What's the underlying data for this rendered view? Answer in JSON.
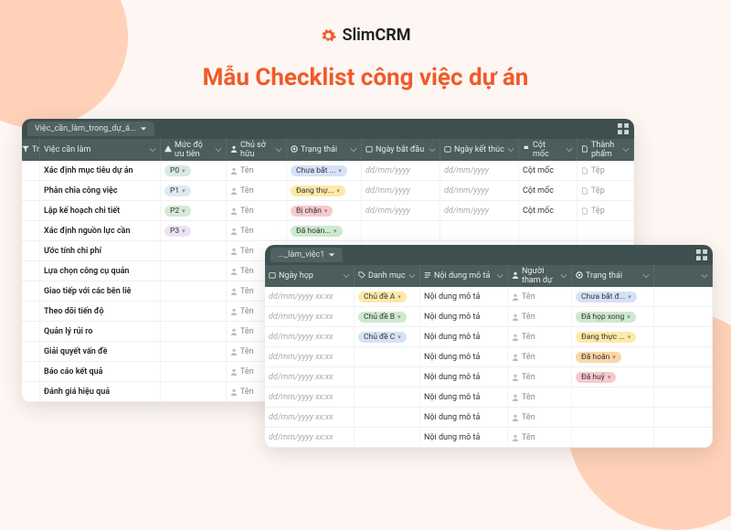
{
  "brand": {
    "slim": "Slim",
    "crm": "CRM"
  },
  "headline": "Mẫu Checklist công việc dự án",
  "colors": {
    "accent": "#f05a28",
    "header_bg": "#4b5d5c",
    "tabbar_bg": "#3d4f4f"
  },
  "panel_a": {
    "tab": "Việc_cần_làm_trong_dự_á...",
    "columns": [
      "Tr",
      "Việc cần làm",
      "Mức độ ưu tiên",
      "Chủ sở hữu",
      "Trạng thái",
      "Ngày bắt đầu",
      "Ngày kết thúc",
      "Cột mốc",
      "Thành phẩm"
    ],
    "icons": [
      "filter",
      "",
      "priority",
      "person",
      "status",
      "calendar",
      "calendar",
      "milestone",
      "file"
    ],
    "priority_colors": {
      "P0": "#d7e9e2",
      "P1": "#dfe9f5",
      "P2": "#d4ead6",
      "P3": "#ece3f2"
    },
    "status_colors": {
      "Chưa bắt ...": "#d7e1f7",
      "Đang thự...": "#fde9a8",
      "Bị chặn": "#f7c9ce",
      "Đã hoàn...": "#cde9cf"
    },
    "rows": [
      {
        "task": "Xác định mục tiêu dự án",
        "priority": "P0",
        "owner": "Tên",
        "status": "Chưa bắt ...",
        "start": "dd/mm/yyyy",
        "end": "dd/mm/yyyy",
        "milestone": "Cột mốc",
        "file": "Tệp"
      },
      {
        "task": "Phân chia công việc",
        "priority": "P1",
        "owner": "Tên",
        "status": "Đang thự...",
        "start": "dd/mm/yyyy",
        "end": "dd/mm/yyyy",
        "milestone": "Cột mốc",
        "file": "Tệp"
      },
      {
        "task": "Lập kế hoạch chi tiết",
        "priority": "P2",
        "owner": "Tên",
        "status": "Bị chặn",
        "start": "dd/mm/yyyy",
        "end": "dd/mm/yyyy",
        "milestone": "Cột mốc",
        "file": "Tệp"
      },
      {
        "task": "Xác định nguồn lực cần",
        "priority": "P3",
        "owner": "Tên",
        "status": "Đã hoàn...",
        "start": "",
        "end": "",
        "milestone": "",
        "file": ""
      },
      {
        "task": "Ước tính chi phí",
        "priority": "",
        "owner": "Tên",
        "status": "",
        "start": "",
        "end": "",
        "milestone": "",
        "file": ""
      },
      {
        "task": "Lựa chọn công cụ quản",
        "priority": "",
        "owner": "Tên",
        "status": "",
        "start": "",
        "end": "",
        "milestone": "",
        "file": ""
      },
      {
        "task": "Giao tiếp với các bên liê",
        "priority": "",
        "owner": "Tên",
        "status": "",
        "start": "",
        "end": "",
        "milestone": "",
        "file": ""
      },
      {
        "task": "Theo dõi tiến độ",
        "priority": "",
        "owner": "Tên",
        "status": "",
        "start": "",
        "end": "",
        "milestone": "",
        "file": ""
      },
      {
        "task": "Quản lý rủi ro",
        "priority": "",
        "owner": "Tên",
        "status": "",
        "start": "",
        "end": "",
        "milestone": "",
        "file": ""
      },
      {
        "task": "Giải quyết vấn đề",
        "priority": "",
        "owner": "Tên",
        "status": "",
        "start": "",
        "end": "",
        "milestone": "",
        "file": ""
      },
      {
        "task": "Báo cáo kết quả",
        "priority": "",
        "owner": "Tên",
        "status": "",
        "start": "",
        "end": "",
        "milestone": "",
        "file": ""
      },
      {
        "task": "Đánh giá hiệu quả",
        "priority": "",
        "owner": "Tên",
        "status": "",
        "start": "",
        "end": "",
        "milestone": "",
        "file": ""
      }
    ]
  },
  "panel_b": {
    "tab": "..._làm_việc1",
    "columns": [
      "Ngày họp",
      "Danh mục",
      "Nội dung mô tả",
      "Người tham dự",
      "Trạng thái",
      ""
    ],
    "icons": [
      "calendar",
      "tag",
      "text",
      "person",
      "status",
      ""
    ],
    "category_colors": {
      "Chủ đề A": "#fde9a8",
      "Chủ đề B": "#cde9cf",
      "Chủ đề C": "#d7e1f7"
    },
    "status_colors": {
      "Chưa bắt đ...": "#d7e1f7",
      "Đã họp xong": "#cde9cf",
      "Đang thực ...": "#fde9a8",
      "Đã hoãn": "#f9d7a8",
      "Đã huỷ": "#f7c9ce"
    },
    "rows": [
      {
        "date": "dd/mm/yyyy xx:xx",
        "category": "Chủ đề A",
        "desc": "Nội dung mô tả",
        "people": "Tên",
        "status": "Chưa bắt đ..."
      },
      {
        "date": "dd/mm/yyyy xx:xx",
        "category": "Chủ đề B",
        "desc": "Nội dung mô tả",
        "people": "Tên",
        "status": "Đã họp xong"
      },
      {
        "date": "dd/mm/yyyy xx:xx",
        "category": "Chủ đề C",
        "desc": "Nội dung mô tả",
        "people": "Tên",
        "status": "Đang thực ..."
      },
      {
        "date": "dd/mm/yyyy xx:xx",
        "category": "",
        "desc": "Nội dung mô tả",
        "people": "Tên",
        "status": "Đã hoãn"
      },
      {
        "date": "dd/mm/yyyy xx:xx",
        "category": "",
        "desc": "Nội dung mô tả",
        "people": "Tên",
        "status": "Đã huỷ"
      },
      {
        "date": "dd/mm/yyyy xx:xx",
        "category": "",
        "desc": "Nội dung mô tả",
        "people": "Tên",
        "status": ""
      },
      {
        "date": "dd/mm/yyyy xx:xx",
        "category": "",
        "desc": "Nội dung mô tả",
        "people": "Tên",
        "status": ""
      },
      {
        "date": "dd/mm/yyyy xx:xx",
        "category": "",
        "desc": "Nội dung mô tả",
        "people": "Tên",
        "status": ""
      }
    ]
  }
}
